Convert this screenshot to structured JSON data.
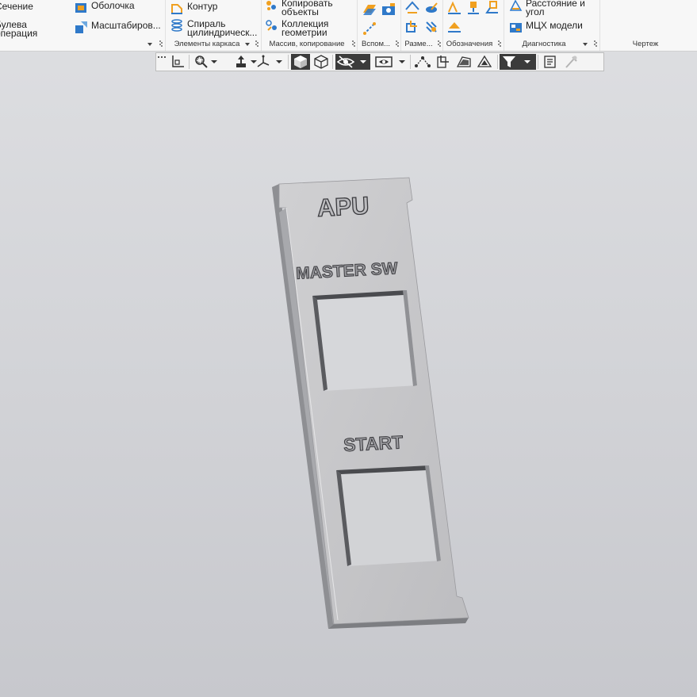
{
  "ribbon": {
    "groups": [
      {
        "id": "ops",
        "label": "",
        "buttons": [
          {
            "label": "Сечение",
            "icon": "section-icon"
          },
          {
            "label": "Булева\nоперация",
            "icon": "boolean-icon"
          },
          {
            "label": "Оболочка",
            "icon": "shell-icon"
          },
          {
            "label": "Масштабиров...",
            "icon": "scale-icon"
          }
        ]
      },
      {
        "id": "frame",
        "label": "Элементы каркаса",
        "buttons": [
          {
            "label": "Контур",
            "icon": "contour-icon"
          },
          {
            "label": "Спираль\nцилиндрическ...",
            "icon": "spiral-icon"
          }
        ]
      },
      {
        "id": "array",
        "label": "Массив, копирование",
        "buttons": [
          {
            "label": "Копировать\nобъекты",
            "icon": "copy-objects-icon"
          },
          {
            "label": "Коллекция\nгеометрии",
            "icon": "geometry-collection-icon"
          }
        ]
      },
      {
        "id": "aux",
        "label": "Вспом...",
        "buttons": []
      },
      {
        "id": "dims",
        "label": "Разме...",
        "buttons": []
      },
      {
        "id": "notes",
        "label": "Обозначения",
        "buttons": []
      },
      {
        "id": "diag",
        "label": "Диагностика",
        "buttons": [
          {
            "label": "Расстояние и\nугол",
            "icon": "distance-angle-icon"
          },
          {
            "label": "МЦХ модели",
            "icon": "mass-properties-icon"
          }
        ]
      },
      {
        "id": "drawing",
        "label": "Чертеж",
        "buttons": []
      }
    ]
  },
  "model": {
    "labels": {
      "top": "APU",
      "middle": "MASTER SW",
      "bottom": "START"
    }
  },
  "colors": {
    "accent_blue": "#2f79c9",
    "accent_orange": "#f0a020",
    "part_face": "#c8c8ca",
    "part_side": "#8e8f93",
    "toolbar_dark": "#3b3b3b"
  }
}
